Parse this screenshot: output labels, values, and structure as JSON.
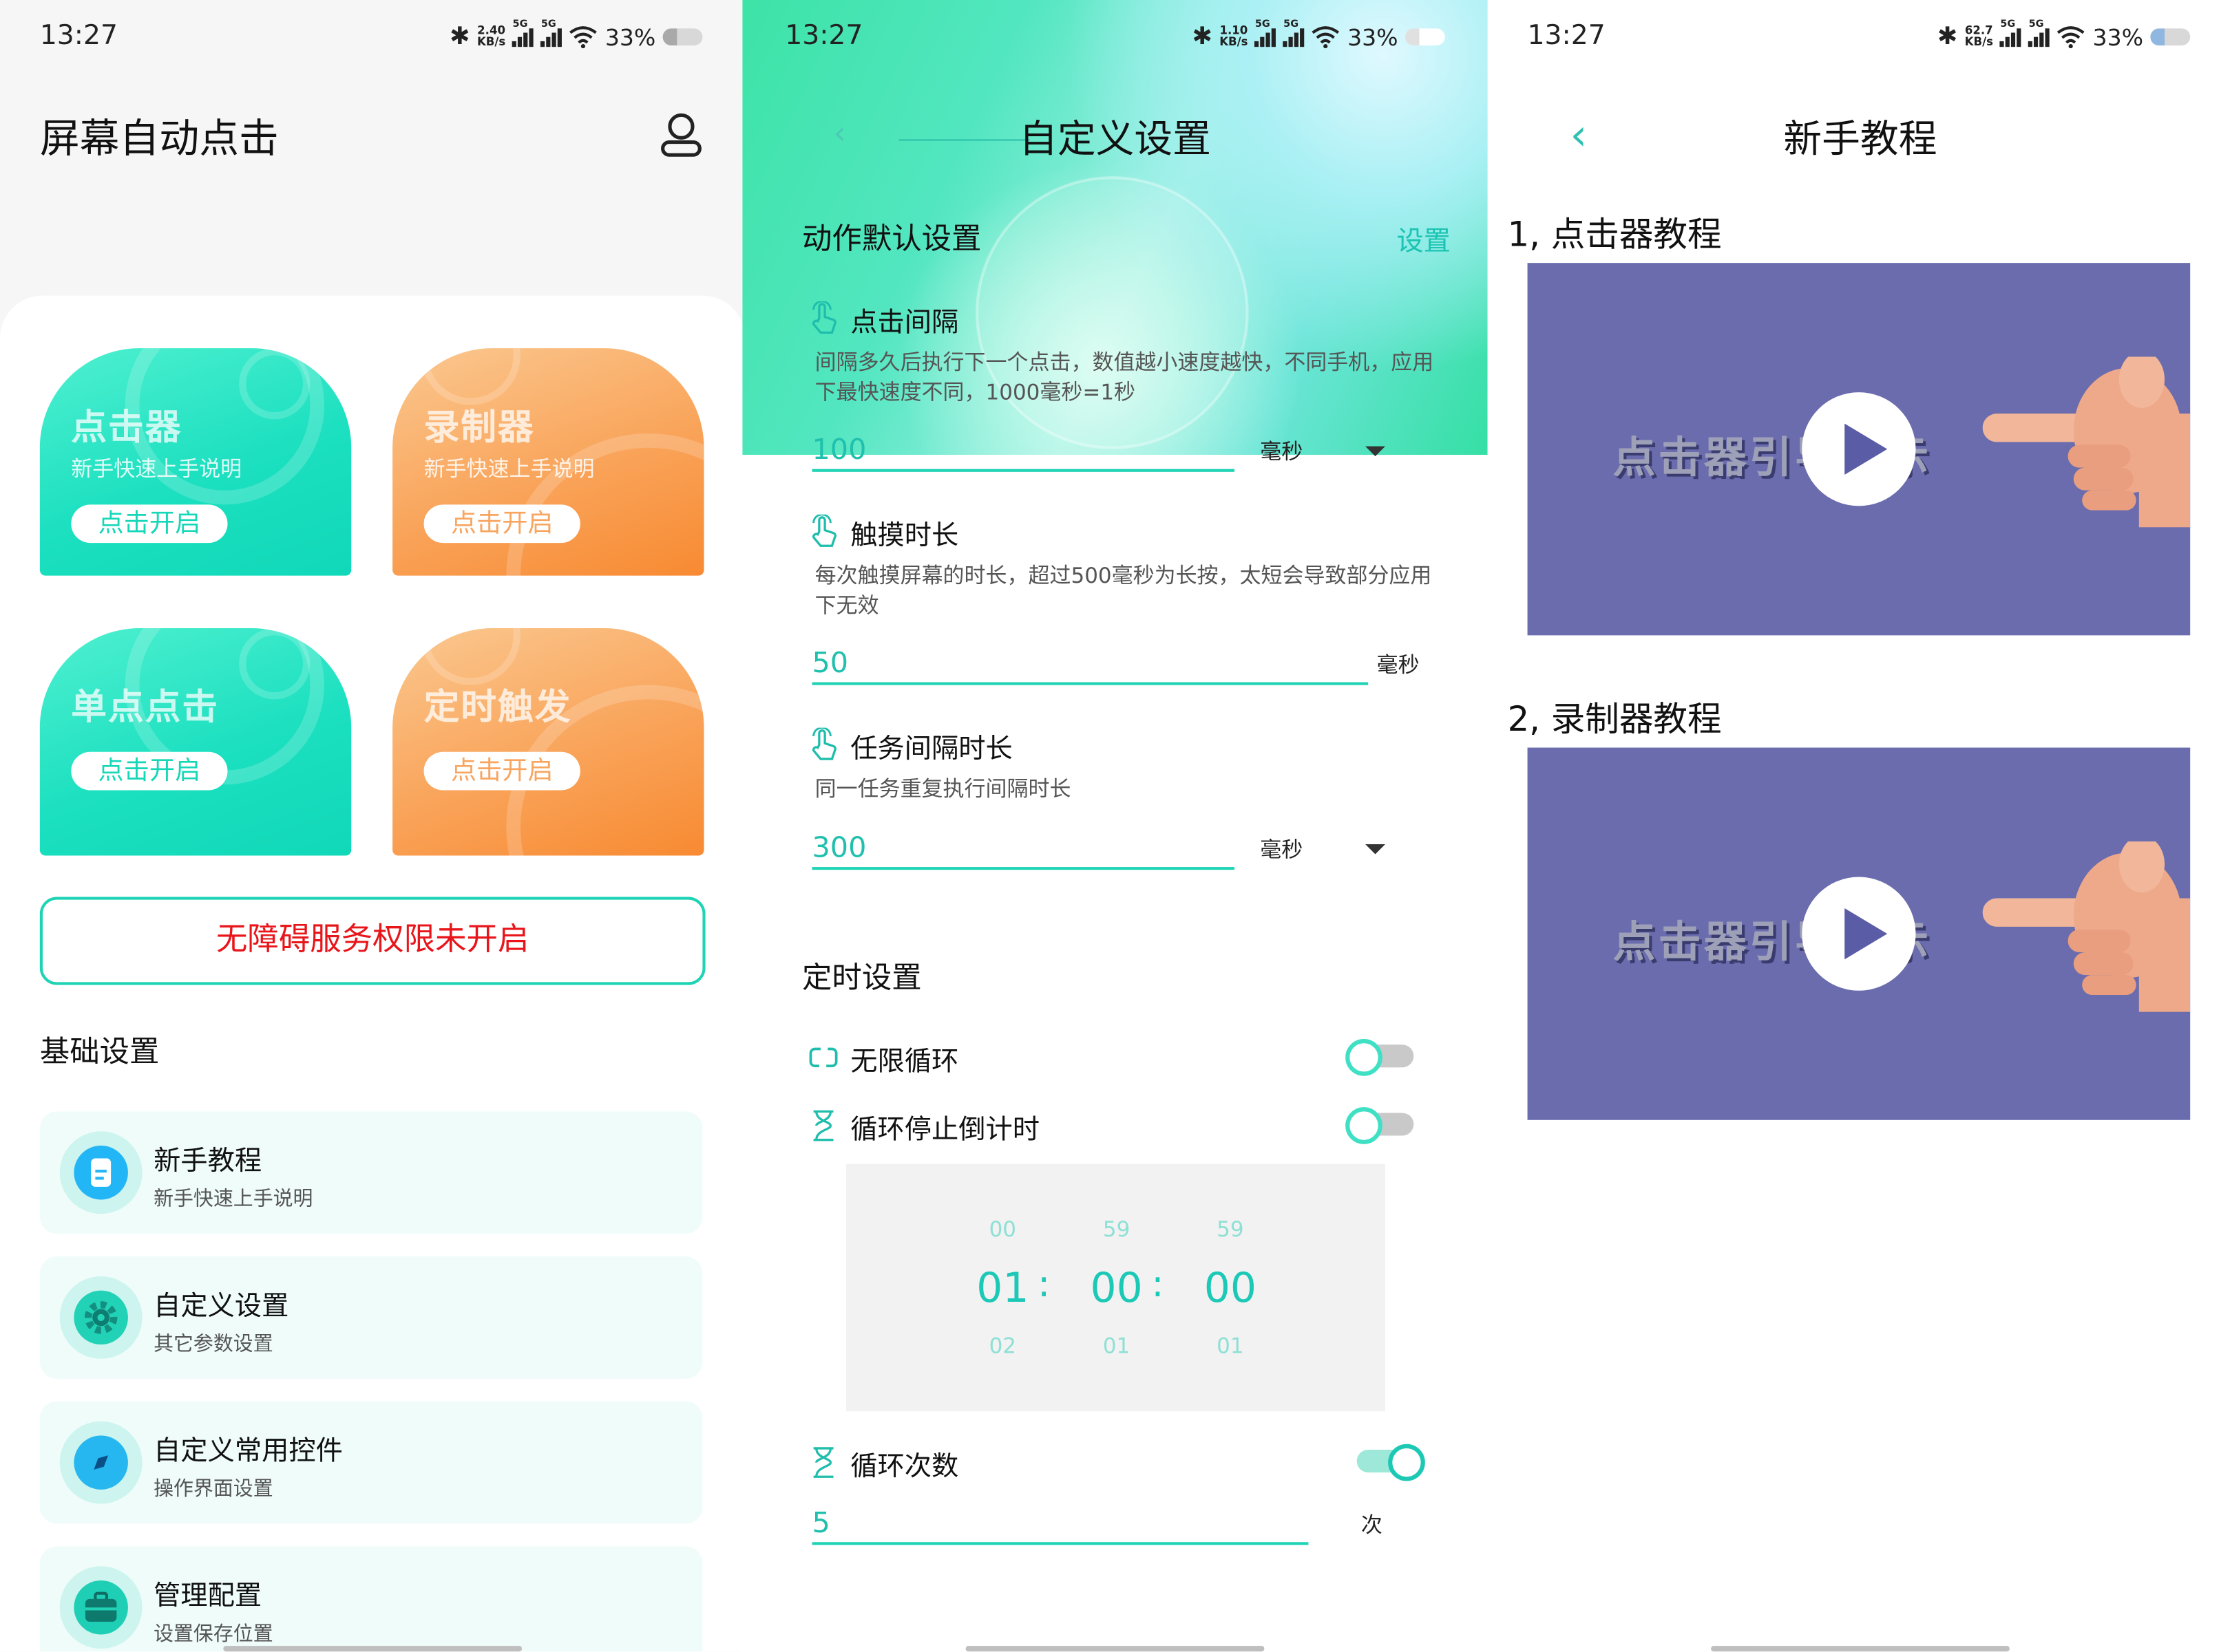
{
  "status": {
    "time": "13:27",
    "battery": "33%",
    "net": "5G",
    "unit": "KB/s",
    "speed1": "2.40",
    "speed2": "1.10",
    "speed3": "62.7"
  },
  "screen1": {
    "title": "屏幕自动点击",
    "cards": [
      {
        "title": "点击器",
        "subtitle": "新手快速上手说明",
        "button": "点击开启"
      },
      {
        "title": "录制器",
        "subtitle": "新手快速上手说明",
        "button": "点击开启"
      },
      {
        "title": "单点点击",
        "button": "点击开启"
      },
      {
        "title": "定时触发",
        "button": "点击开启"
      }
    ],
    "warning_button": "无障碍服务权限未开启",
    "section": "基础设置",
    "items": [
      {
        "title": "新手教程",
        "desc": "新手快速上手说明"
      },
      {
        "title": "自定义设置",
        "desc": "其它参数设置"
      },
      {
        "title": "自定义常用控件",
        "desc": "操作界面设置"
      },
      {
        "title": "管理配置",
        "desc": "设置保存位置"
      }
    ],
    "colors": {
      "accent": "#1fd3b5",
      "warning": "#e8151b",
      "green_card": "#1ce0c0",
      "orange_card": "#f9a45a"
    }
  },
  "screen2": {
    "title": "自定义设置",
    "section1": "动作默认设置",
    "settings_link": "设置",
    "click_interval": {
      "label": "点击间隔",
      "desc": "间隔多久后执行下一个点击，数值越小速度越快，不同手机，应用下最快速度不同，1000毫秒=1秒",
      "value": "100",
      "unit": "毫秒"
    },
    "touch_duration": {
      "label": "触摸时长",
      "desc": "每次触摸屏幕的时长，超过500毫秒为长按，太短会导致部分应用下无效",
      "value": "50",
      "unit": "毫秒"
    },
    "task_interval": {
      "label": "任务间隔时长",
      "desc": "同一任务重复执行间隔时长",
      "value": "300",
      "unit": "毫秒"
    },
    "section2": "定时设置",
    "infinite_loop": {
      "label": "无限循环",
      "on": false
    },
    "loop_countdown": {
      "label": "循环停止倒计时",
      "on": false
    },
    "time_picker": {
      "above": [
        "00",
        "59",
        "59"
      ],
      "selected": [
        "01",
        "00",
        "00"
      ],
      "below": [
        "02",
        "01",
        "01"
      ],
      "separator": ":"
    },
    "loop_count": {
      "label": "循环次数",
      "on": true,
      "value": "5",
      "unit": "次"
    }
  },
  "screen3": {
    "title": "新手教程",
    "tutorials": [
      {
        "heading": "1, 点击器教程",
        "video_text": "点击器引导指示"
      },
      {
        "heading": "2, 录制器教程",
        "video_text": "点击器引导指示"
      }
    ]
  }
}
